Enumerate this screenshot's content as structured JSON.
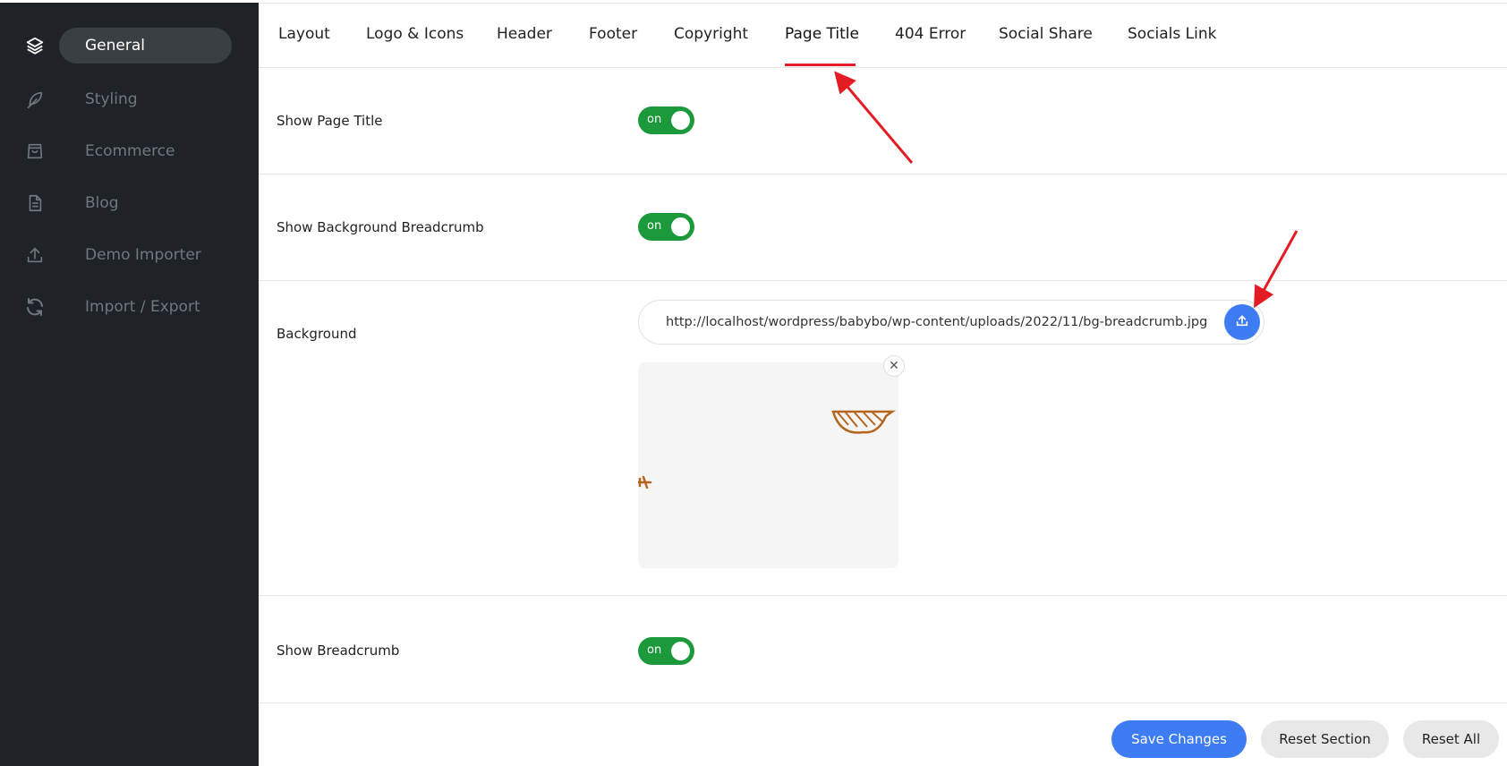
{
  "sidebar": {
    "items": [
      {
        "label": "General",
        "icon": "layers-icon",
        "active": true
      },
      {
        "label": "Styling",
        "icon": "feather-icon",
        "active": false
      },
      {
        "label": "Ecommerce",
        "icon": "shopping-bag-icon",
        "active": false
      },
      {
        "label": "Blog",
        "icon": "document-icon",
        "active": false
      },
      {
        "label": "Demo Importer",
        "icon": "upload-icon",
        "active": false
      },
      {
        "label": "Import / Export",
        "icon": "refresh-icon",
        "active": false
      }
    ]
  },
  "tabs": [
    {
      "label": "Layout"
    },
    {
      "label": "Logo & Icons"
    },
    {
      "label": "Header"
    },
    {
      "label": "Footer"
    },
    {
      "label": "Copyright"
    },
    {
      "label": "Page Title",
      "active": true
    },
    {
      "label": "404 Error"
    },
    {
      "label": "Social Share"
    },
    {
      "label": "Socials Link"
    }
  ],
  "settings": {
    "show_page_title": {
      "label": "Show Page Title",
      "toggle": "on"
    },
    "show_background_breadcrumb": {
      "label": "Show Background Breadcrumb",
      "toggle": "on"
    },
    "background": {
      "label": "Background",
      "url": "http://localhost/wordpress/babybo/wp-content/uploads/2022/11/bg-breadcrumb.jpg",
      "close_glyph": "✕"
    },
    "show_breadcrumb": {
      "label": "Show Breadcrumb",
      "toggle": "on"
    }
  },
  "footer": {
    "save_label": "Save Changes",
    "reset_section_label": "Reset Section",
    "reset_all_label": "Reset All"
  },
  "colors": {
    "sidebar_bg": "#1f2327",
    "accent_blue": "#3d7cf2",
    "toggle_green": "#1c9a3b",
    "active_tab_underline": "#e31b23",
    "annotation_arrow": "#e31b23"
  }
}
